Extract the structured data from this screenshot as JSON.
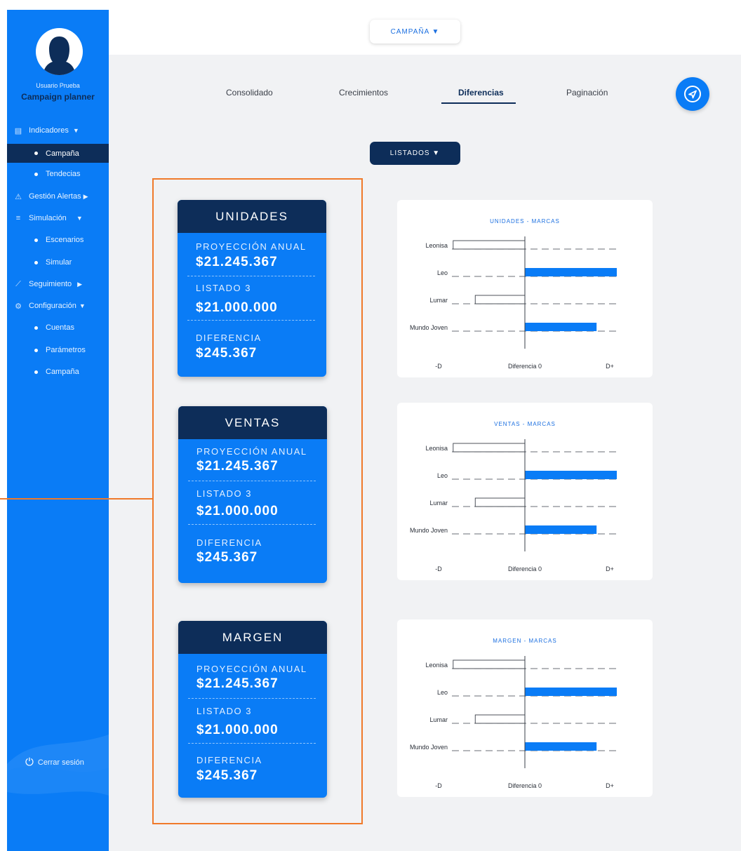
{
  "sidebar": {
    "user_name": "Usuario Prueba",
    "user_role": "Campaign planner",
    "items": [
      {
        "label": "Indicadores",
        "icon": "dashboard-icon",
        "arrow": "▼"
      },
      {
        "label": "Campaña"
      },
      {
        "label": "Tendecias"
      },
      {
        "label": "Gestión Alertas",
        "icon": "alert-icon",
        "arrow": "▶"
      },
      {
        "label": "Simulación",
        "icon": "sliders-icon",
        "arrow": "▼"
      },
      {
        "label": "Escenarios"
      },
      {
        "label": "Simular"
      },
      {
        "label": "Seguimiento",
        "icon": "trend-icon",
        "arrow": "▶"
      },
      {
        "label": "Configuración",
        "icon": "gear-icon",
        "arrow": "▼"
      },
      {
        "label": "Cuentas"
      },
      {
        "label": "Parámetros"
      },
      {
        "label": "Campaña"
      }
    ],
    "logout": "Cerrar sesión"
  },
  "header": {
    "campaign_select": "CAMPAÑA ▼"
  },
  "tabs": [
    {
      "label": "Consolidado"
    },
    {
      "label": "Crecimientos"
    },
    {
      "label": "Diferencias",
      "active": true
    },
    {
      "label": "Paginación"
    }
  ],
  "listados_select": "LISTADOS ▼",
  "cards": [
    {
      "title": "UNIDADES",
      "proj_label": "PROYECCIÓN ANUAL",
      "proj_value": "$21.245.367",
      "list_label": "LISTADO 3",
      "list_value": "$21.000.000",
      "diff_label": "DIFERENCIA",
      "diff_value": "$245.367"
    },
    {
      "title": "VENTAS",
      "proj_label": "PROYECCIÓN ANUAL",
      "proj_value": "$21.245.367",
      "list_label": "LISTADO 3",
      "list_value": "$21.000.000",
      "diff_label": "DIFERENCIA",
      "diff_value": "$245.367"
    },
    {
      "title": "MARGEN",
      "proj_label": "PROYECCIÓN ANUAL",
      "proj_value": "$21.245.367",
      "list_label": "LISTADO 3",
      "list_value": "$21.000.000",
      "diff_label": "DIFERENCIA",
      "diff_value": "$245.367"
    }
  ],
  "colors": {
    "primary": "#0a7cf6",
    "dark": "#0d2d59",
    "highlight": "#f07a2a",
    "background": "#f1f2f4"
  },
  "chart_data": [
    {
      "type": "bar",
      "orientation": "horizontal",
      "title": "UNIDADES - MARCAS",
      "categories": [
        "Leonisa",
        "Leo",
        "Lumar",
        "Mundo Joven"
      ],
      "values": [
        -0.78,
        1.0,
        -0.54,
        0.78
      ],
      "xlim": [
        -1,
        1
      ],
      "x_ticks": [
        "-D",
        "Diferencia 0",
        "D+"
      ]
    },
    {
      "type": "bar",
      "orientation": "horizontal",
      "title": "VENTAS - MARCAS",
      "categories": [
        "Leonisa",
        "Leo",
        "Lumar",
        "Mundo Joven"
      ],
      "values": [
        -0.78,
        1.0,
        -0.54,
        0.78
      ],
      "xlim": [
        -1,
        1
      ],
      "x_ticks": [
        "-D",
        "Diferencia 0",
        "D+"
      ]
    },
    {
      "type": "bar",
      "orientation": "horizontal",
      "title": "MARGEN - MARCAS",
      "categories": [
        "Leonisa",
        "Leo",
        "Lumar",
        "Mundo Joven"
      ],
      "values": [
        -0.78,
        1.0,
        -0.54,
        0.78
      ],
      "xlim": [
        -1,
        1
      ],
      "x_ticks": [
        "-D",
        "Diferencia 0",
        "D+"
      ]
    }
  ]
}
